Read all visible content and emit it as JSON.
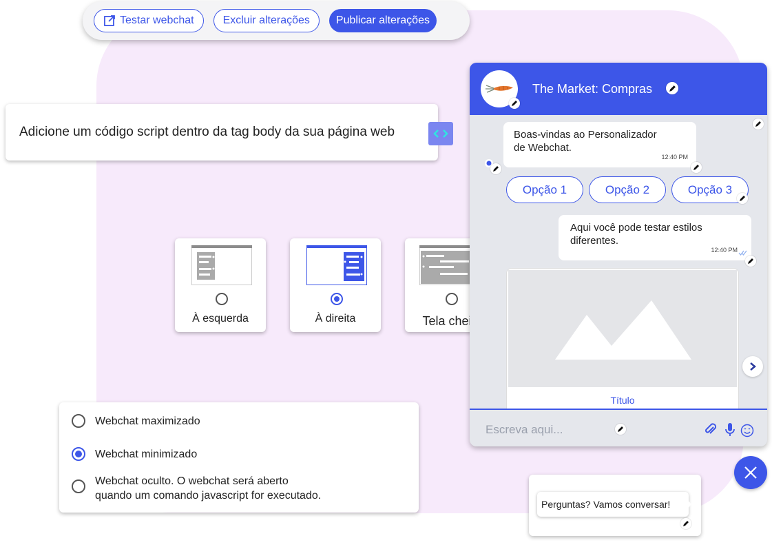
{
  "toolbar": {
    "test_label": "Testar webchat",
    "discard_label": "Excluir alterações",
    "publish_label": "Publicar alterações"
  },
  "script": {
    "text": "Adicione um código script dentro da tag body da sua página web"
  },
  "layouts": [
    {
      "label": "À esquerda",
      "selected": false
    },
    {
      "label": "À direita",
      "selected": true
    },
    {
      "label": "Tela cheia",
      "selected": false
    }
  ],
  "visibility": [
    {
      "label": "Webchat maximizado",
      "selected": false
    },
    {
      "label": "Webchat minimizado",
      "selected": true
    },
    {
      "label": "Webchat oculto. O webchat será aberto",
      "label2": "quando um comando javascript for executado.",
      "selected": false
    }
  ],
  "chat": {
    "title": "The Market: Compras",
    "msg_in_line1": "Boas-vindas ao Personalizador",
    "msg_in_line2": "de Webchat.",
    "msg_in_time": "12:40 PM",
    "options": [
      "Opção 1",
      "Opção 2",
      "Opção 3"
    ],
    "msg_out_line1": "Aqui você pode testar estilos",
    "msg_out_line2": "diferentes.",
    "msg_out_time": "12:40 PM",
    "card_title": "Título",
    "input_placeholder": "Escreva aqui..."
  },
  "tooltip": {
    "text": "Perguntas? Vamos conversar!"
  },
  "colors": {
    "accent": "#3d56e8",
    "background_blob": "#f7eafb"
  }
}
